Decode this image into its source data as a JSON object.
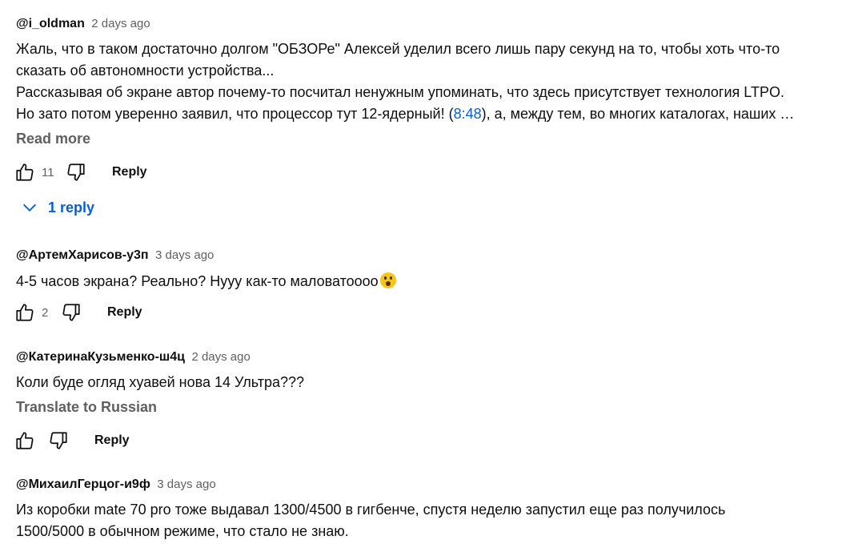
{
  "comments": [
    {
      "author": "@i_oldman",
      "time": "2 days ago",
      "line1": "Жаль, что в таком достаточно долгом \"ОБЗОРе\" Алексей уделил всего лишь пару секунд на то, чтобы хоть что-то",
      "line2": "сказать об автономности устройства...",
      "line3": "Рассказывая об экране автор почему-то посчитал ненужным упоминать, что здесь присутствует технология LTPO.",
      "line4_pre": "Но зато потом уверенно заявил, что процессор тут 12-ядерный! (",
      "timestamp": "8:48",
      "line4_post": "), а, между тем, во многих каталогах, наших …",
      "read_more": "Read more",
      "likes": "11",
      "reply_label": "Reply",
      "replies_label": "1 reply"
    },
    {
      "author": "@АртемХарисов-у3п",
      "time": "3 days ago",
      "text": "4-5 часов экрана? Реально? Нууу как-то маловатоооо",
      "emoji": "astonished-face",
      "likes": "2",
      "reply_label": "Reply"
    },
    {
      "author": "@КатеринаКузьменко-ш4ц",
      "time": "2 days ago",
      "text": "Коли буде огляд хуавей нова 14 Ультра???",
      "translate": "Translate to Russian",
      "reply_label": "Reply"
    },
    {
      "author": "@МихаилГерцог-и9ф",
      "time": "3 days ago",
      "line1": "Из коробки mate 70 pro тоже выдавал 1300/4500 в гигбенче, спустя неделю запустил еще раз получилось",
      "line2": "1500/5000 в обычном режиме, что стало не знаю."
    }
  ],
  "colors": {
    "link": "#065fd4",
    "muted": "#606060",
    "text": "#0f0f0f"
  }
}
